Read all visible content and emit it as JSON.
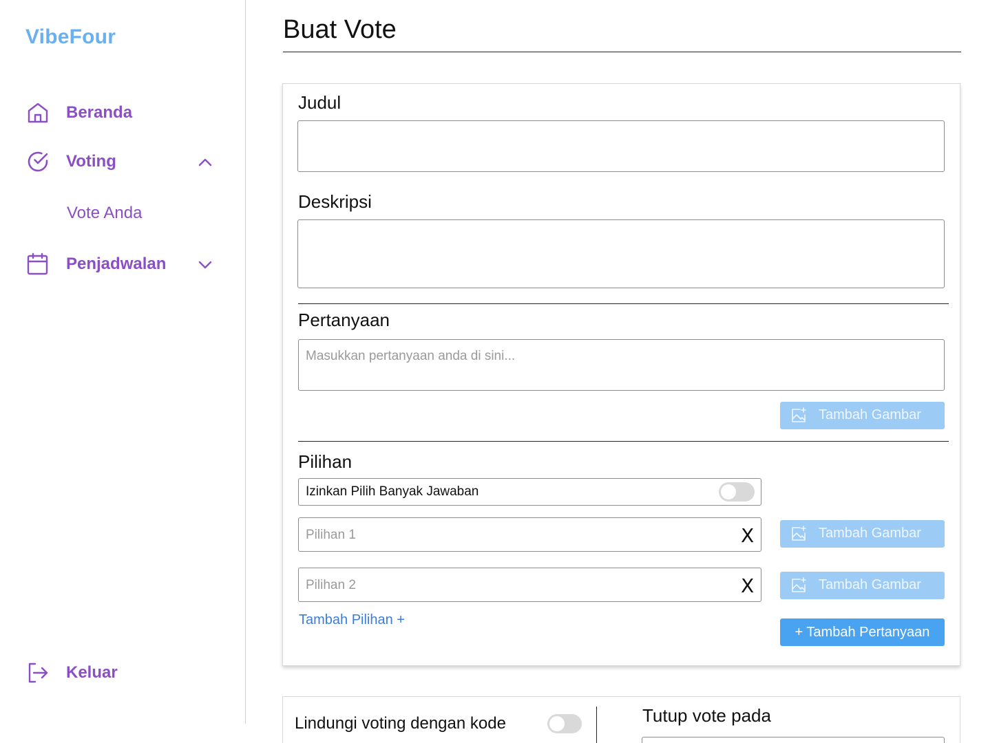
{
  "app": {
    "logo": "VibeFour"
  },
  "sidebar": {
    "items": [
      {
        "label": "Beranda",
        "icon": "home-icon"
      },
      {
        "label": "Voting",
        "icon": "check-circle-icon",
        "expanded": true
      },
      {
        "label": "Penjadwalan",
        "icon": "calendar-icon",
        "expanded": false
      }
    ],
    "sub_items": [
      {
        "label": "Vote Anda"
      }
    ],
    "logout": {
      "label": "Keluar",
      "icon": "logout-icon"
    }
  },
  "page": {
    "title": "Buat Vote"
  },
  "form": {
    "judul": {
      "label": "Judul",
      "value": ""
    },
    "deskripsi": {
      "label": "Deskripsi",
      "value": ""
    },
    "pertanyaan": {
      "label": "Pertanyaan",
      "placeholder": "Masukkan pertanyaan anda di sini...",
      "image_button": "Tambah Gambar"
    },
    "pilihan": {
      "label": "Pilihan",
      "multi_answer_label": "Izinkan Pilih Banyak Jawaban",
      "multi_answer_enabled": false,
      "options": [
        {
          "placeholder": "Pilihan 1",
          "remove": "X",
          "image_button": "Tambah Gambar"
        },
        {
          "placeholder": "Pilihan 2",
          "remove": "X",
          "image_button": "Tambah Gambar"
        }
      ],
      "add_option": "Tambah Pilihan +",
      "add_question": "+ Tambah Pertanyaan"
    }
  },
  "settings": {
    "protect_label": "Lindungi voting dengan kode",
    "protect_enabled": false,
    "close_label": "Tutup vote pada"
  },
  "colors": {
    "brand": "#6ab0f0",
    "nav": "#8a4fc6",
    "primary": "#4aa3f0",
    "primary_disabled": "#9ccbf6",
    "link": "#3b7dd8"
  }
}
